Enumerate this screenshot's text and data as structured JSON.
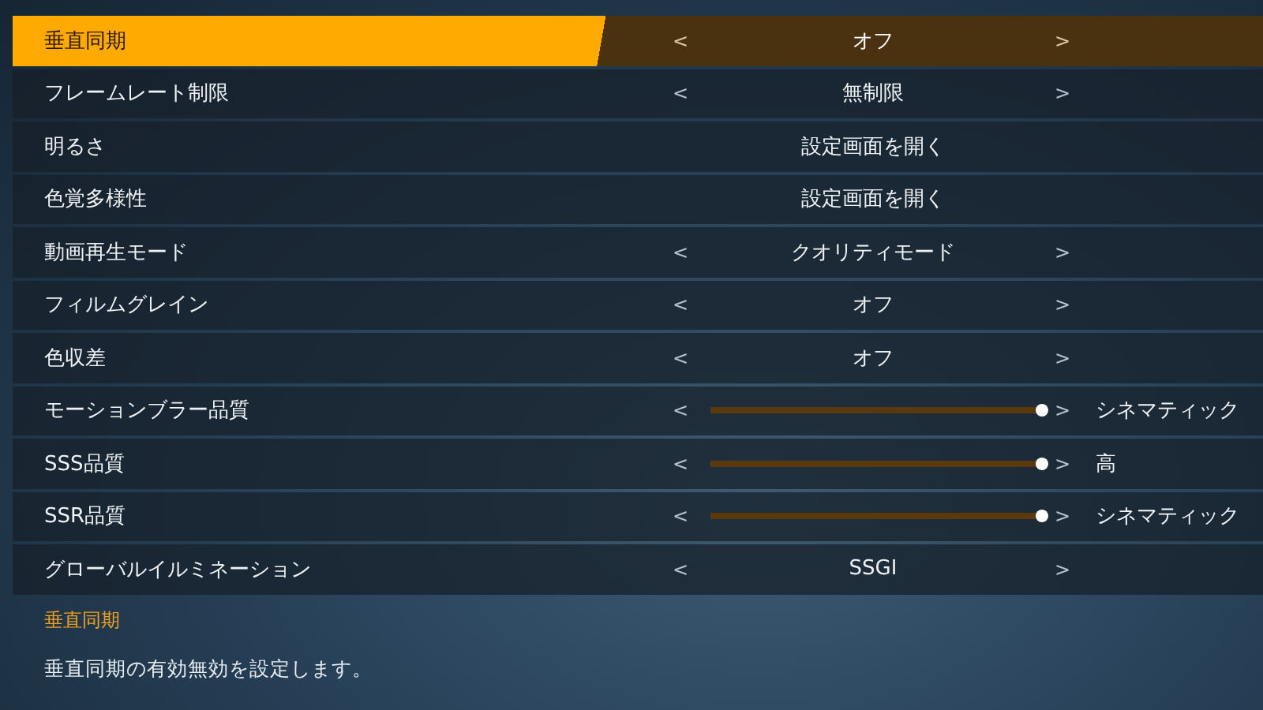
{
  "settings": [
    {
      "label": "垂直同期",
      "kind": "select",
      "value": "オフ",
      "selected": true
    },
    {
      "label": "フレームレート制限",
      "kind": "select",
      "value": "無制限",
      "selected": false
    },
    {
      "label": "明るさ",
      "kind": "link",
      "value": "設定画面を開く",
      "selected": false
    },
    {
      "label": "色覚多様性",
      "kind": "link",
      "value": "設定画面を開く",
      "selected": false
    },
    {
      "label": "動画再生モード",
      "kind": "select",
      "value": "クオリティモード",
      "selected": false
    },
    {
      "label": "フィルムグレイン",
      "kind": "select",
      "value": "オフ",
      "selected": false
    },
    {
      "label": "色収差",
      "kind": "select",
      "value": "オフ",
      "selected": false
    },
    {
      "label": "モーションブラー品質",
      "kind": "slider",
      "level": 1,
      "value": "シネマティック",
      "selected": false
    },
    {
      "label": "SSS品質",
      "kind": "slider",
      "level": 1,
      "value": "高",
      "selected": false
    },
    {
      "label": "SSR品質",
      "kind": "slider",
      "level": 1,
      "value": "シネマティック",
      "selected": false
    },
    {
      "label": "グローバルイルミネーション",
      "kind": "select",
      "value": "SSGI",
      "selected": false
    }
  ],
  "arrows": {
    "left": "<",
    "right": ">"
  },
  "help": {
    "title": "垂直同期",
    "text": "垂直同期の有効無効を設定します。"
  }
}
